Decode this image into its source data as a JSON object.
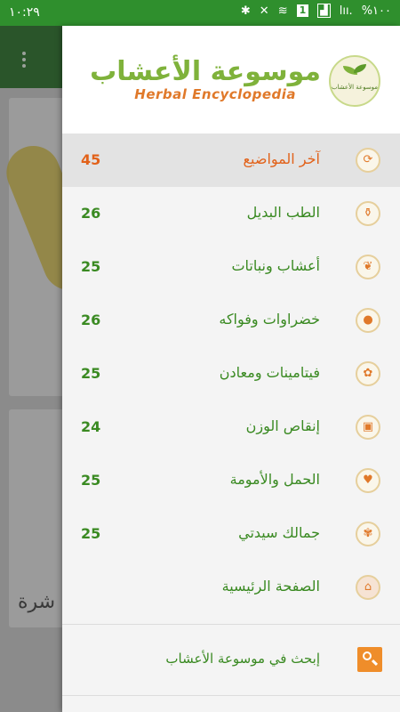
{
  "status_bar": {
    "time": "١٠:٢٩",
    "battery": "%١٠٠",
    "signal": "lıı.",
    "sim_badge": "1",
    "icons": [
      "signal-icon",
      "sim-icon",
      "wifi-icon",
      "mute-icon",
      "bluetooth-icon"
    ]
  },
  "background": {
    "overlay_text": "شرة"
  },
  "drawer": {
    "logo": {
      "arabic": "موسوعة الأعشاب",
      "english": "Herbal Encyclopedia",
      "badge_text": "موسوعة الأعشاب"
    },
    "items": [
      {
        "label": "آخر المواضيع",
        "count": "45",
        "icon": "refresh-icon",
        "active": true
      },
      {
        "label": "الطب البديل",
        "count": "26",
        "icon": "mortar-icon"
      },
      {
        "label": "أعشاب ونباتات",
        "count": "25",
        "icon": "leaf-icon"
      },
      {
        "label": "خضراوات وفواكه",
        "count": "26",
        "icon": "apple-icon"
      },
      {
        "label": "فيتامينات ومعادن",
        "count": "25",
        "icon": "vitamins-icon"
      },
      {
        "label": "إنقاص الوزن",
        "count": "24",
        "icon": "scale-icon"
      },
      {
        "label": "الحمل والأمومة",
        "count": "25",
        "icon": "mother-icon"
      },
      {
        "label": "جمالك سيدتي",
        "count": "25",
        "icon": "beauty-icon"
      },
      {
        "label": "الصفحة الرئيسية",
        "count": "",
        "icon": "home-icon"
      }
    ],
    "search_label": "إبحث في موسوعة الأعشاب"
  },
  "colors": {
    "status_bar": "#2f8f2d",
    "accent_green": "#3a8a22",
    "active_orange": "#e2621a",
    "search_orange": "#ef8d2a"
  }
}
